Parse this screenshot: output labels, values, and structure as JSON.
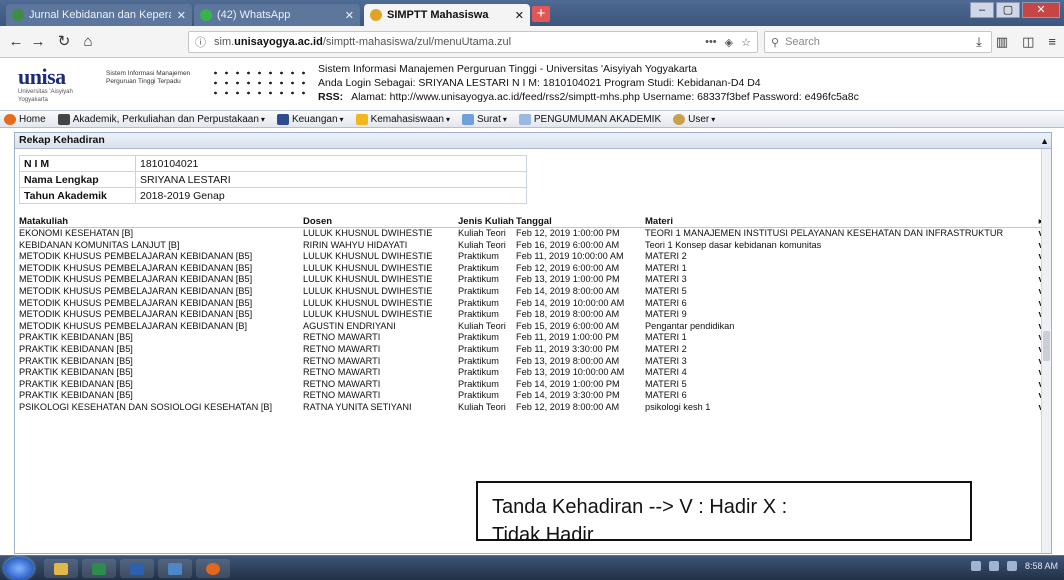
{
  "browser": {
    "tabs": [
      {
        "label": "Jurnal Kebidanan dan Kepera...",
        "active": false,
        "favicon_color": "#3f8c44"
      },
      {
        "label": "(42) WhatsApp",
        "active": false,
        "favicon_color": "#36b34a"
      },
      {
        "label": "SIMPTT Mahasiswa",
        "active": true,
        "favicon_color": "#e0a526"
      }
    ],
    "url_prefix": "sim.",
    "url_domain": "unisayogya.ac.id",
    "url_path": "/simptt-mahasiswa/zul/menuUtama.zul",
    "search_placeholder": "Search"
  },
  "header": {
    "logo_text": "unisa",
    "logo_tagline": "Universitas 'Aisyiyah Yogyakarta",
    "system_name": "Sistem Informasi Manajemen Perguruan Tinggi Terpadu",
    "title": "Sistem Informasi Manajemen Perguruan Tinggi - Universitas 'Aisyiyah Yogyakarta",
    "login_line": "Anda Login Sebagai: SRIYANA LESTARI   N I M: 1810104021   Program Studi: Kebidanan-D4 D4",
    "rss_label": "RSS:",
    "rss_line": "Alamat: http://www.unisayogya.ac.id/feed/rss2/simptt-mhs.php   Username: 68337f3bef   Password: e496fc5a8c"
  },
  "menu": {
    "home": "Home",
    "akademik": "Akademik, Perkuliahan dan Perpustakaan",
    "keuangan": "Keuangan",
    "kemahasiswaan": "Kemahasiswaan",
    "surat": "Surat",
    "pengumuman": "PENGUMUMAN AKADEMIK",
    "user": "User"
  },
  "panel": {
    "title": "Rekap Kehadiran",
    "info": [
      {
        "key": "N I M",
        "value": "1810104021"
      },
      {
        "key": "Nama Lengkap",
        "value": "SRIYANA LESTARI"
      },
      {
        "key": "Tahun Akademik",
        "value": "2018-2019 Genap"
      }
    ],
    "columns": [
      "Matakuliah",
      "Dosen",
      "Jenis Kuliah",
      "Tanggal",
      "Materi"
    ],
    "rows": [
      {
        "matakuliah": "EKONOMI KESEHATAN [B]",
        "dosen": "LULUK KHUSNUL DWIHESTIE",
        "jenis": "Kuliah Teori",
        "tanggal": "Feb 12, 2019 1:00:00 PM",
        "materi": "TEORI 1 MANAJEMEN INSTITUSI PELAYANAN KESEHATAN DAN INFRASTRUKTUR",
        "hadir": "v"
      },
      {
        "matakuliah": "KEBIDANAN KOMUNITAS LANJUT [B]",
        "dosen": "RIRIN WAHYU HIDAYATI",
        "jenis": "Kuliah Teori",
        "tanggal": "Feb 16, 2019 6:00:00 AM",
        "materi": "Teori 1 Konsep dasar kebidanan komunitas",
        "hadir": "v"
      },
      {
        "matakuliah": "METODIK KHUSUS PEMBELAJARAN KEBIDANAN [B5]",
        "dosen": "LULUK KHUSNUL DWIHESTIE",
        "jenis": "Praktikum",
        "tanggal": "Feb 11, 2019 10:00:00 AM",
        "materi": "MATERI 2",
        "hadir": "v"
      },
      {
        "matakuliah": "METODIK KHUSUS PEMBELAJARAN KEBIDANAN [B5]",
        "dosen": "LULUK KHUSNUL DWIHESTIE",
        "jenis": "Praktikum",
        "tanggal": "Feb 12, 2019 6:00:00 AM",
        "materi": "MATERI 1",
        "hadir": "v"
      },
      {
        "matakuliah": "METODIK KHUSUS PEMBELAJARAN KEBIDANAN [B5]",
        "dosen": "LULUK KHUSNUL DWIHESTIE",
        "jenis": "Praktikum",
        "tanggal": "Feb 13, 2019 1:00:00 PM",
        "materi": "MATERI 3",
        "hadir": "v"
      },
      {
        "matakuliah": "METODIK KHUSUS PEMBELAJARAN KEBIDANAN [B5]",
        "dosen": "LULUK KHUSNUL DWIHESTIE",
        "jenis": "Praktikum",
        "tanggal": "Feb 14, 2019 8:00:00 AM",
        "materi": "MATERI 5",
        "hadir": "v"
      },
      {
        "matakuliah": "METODIK KHUSUS PEMBELAJARAN KEBIDANAN [B5]",
        "dosen": "LULUK KHUSNUL DWIHESTIE",
        "jenis": "Praktikum",
        "tanggal": "Feb 14, 2019 10:00:00 AM",
        "materi": "MATERI 6",
        "hadir": "v"
      },
      {
        "matakuliah": "METODIK KHUSUS PEMBELAJARAN KEBIDANAN [B5]",
        "dosen": "LULUK KHUSNUL DWIHESTIE",
        "jenis": "Praktikum",
        "tanggal": "Feb 18, 2019 8:00:00 AM",
        "materi": "MATERI 9",
        "hadir": "v"
      },
      {
        "matakuliah": "METODIK KHUSUS PEMBELAJARAN KEBIDANAN [B]",
        "dosen": "AGUSTIN ENDRIYANI",
        "jenis": "Kuliah Teori",
        "tanggal": "Feb 15, 2019 6:00:00 AM",
        "materi": "Pengantar pendidikan",
        "hadir": "v"
      },
      {
        "matakuliah": "PRAKTIK KEBIDANAN [B5]",
        "dosen": "RETNO MAWARTI",
        "jenis": "Praktikum",
        "tanggal": "Feb 11, 2019 1:00:00 PM",
        "materi": "MATERI 1",
        "hadir": "v"
      },
      {
        "matakuliah": "PRAKTIK KEBIDANAN [B5]",
        "dosen": "RETNO MAWARTI",
        "jenis": "Praktikum",
        "tanggal": "Feb 11, 2019 3:30:00 PM",
        "materi": "MATERI 2",
        "hadir": "v"
      },
      {
        "matakuliah": "PRAKTIK KEBIDANAN [B5]",
        "dosen": "RETNO MAWARTI",
        "jenis": "Praktikum",
        "tanggal": "Feb 13, 2019 8:00:00 AM",
        "materi": "MATERI 3",
        "hadir": "v"
      },
      {
        "matakuliah": "PRAKTIK KEBIDANAN [B5]",
        "dosen": "RETNO MAWARTI",
        "jenis": "Praktikum",
        "tanggal": "Feb 13, 2019 10:00:00 AM",
        "materi": "MATERI 4",
        "hadir": "v"
      },
      {
        "matakuliah": "PRAKTIK KEBIDANAN [B5]",
        "dosen": "RETNO MAWARTI",
        "jenis": "Praktikum",
        "tanggal": "Feb 14, 2019 1:00:00 PM",
        "materi": "MATERI 5",
        "hadir": "v"
      },
      {
        "matakuliah": "PRAKTIK KEBIDANAN [B5]",
        "dosen": "RETNO MAWARTI",
        "jenis": "Praktikum",
        "tanggal": "Feb 14, 2019 3:30:00 PM",
        "materi": "MATERI 6",
        "hadir": "v"
      },
      {
        "matakuliah": "PSIKOLOGI KESEHATAN DAN SOSIOLOGI KESEHATAN [B]",
        "dosen": "RATNA YUNITA SETIYANI",
        "jenis": "Kuliah Teori",
        "tanggal": "Feb 12, 2019 8:00:00 AM",
        "materi": "psikologi kesh 1",
        "hadir": "v"
      }
    ]
  },
  "legend": {
    "line1": "Tanda Kehadiran --> V : Hadir      X :",
    "line2": "Tidak Hadir"
  },
  "taskbar": {
    "clock": "8:58 AM"
  }
}
